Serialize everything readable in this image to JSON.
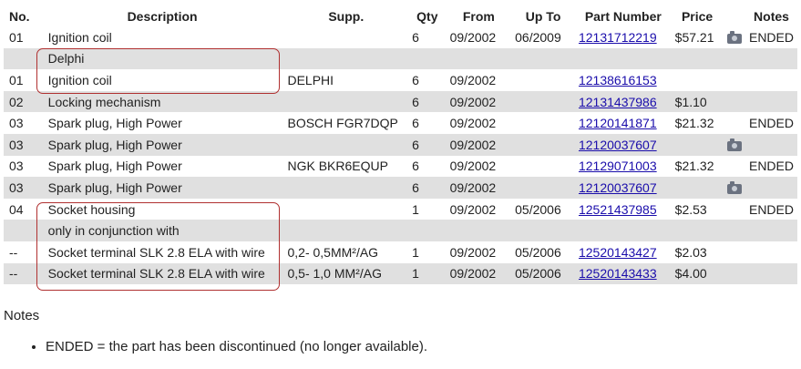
{
  "headers": {
    "no": "No.",
    "description": "Description",
    "supp": "Supp.",
    "qty": "Qty",
    "from": "From",
    "upto": "Up To",
    "part_number": "Part Number",
    "price": "Price",
    "notes": "Notes"
  },
  "rows": [
    {
      "no": "01",
      "desc": "Ignition coil",
      "supp": "",
      "qty": "6",
      "from": "09/2002",
      "upto": "06/2009",
      "part": "12131712219",
      "price": "$57.21",
      "pic": true,
      "note": "ENDED"
    },
    {
      "no": "",
      "desc": "Delphi",
      "supp": "",
      "qty": "",
      "from": "",
      "upto": "",
      "part": "",
      "price": "",
      "pic": false,
      "note": ""
    },
    {
      "no": "01",
      "desc": "Ignition coil",
      "supp": "DELPHI",
      "qty": "6",
      "from": "09/2002",
      "upto": "",
      "part": "12138616153",
      "price": "",
      "pic": false,
      "note": ""
    },
    {
      "no": "02",
      "desc": "Locking mechanism",
      "supp": "",
      "qty": "6",
      "from": "09/2002",
      "upto": "",
      "part": "12131437986",
      "price": "$1.10",
      "pic": false,
      "note": ""
    },
    {
      "no": "03",
      "desc": "Spark plug, High Power",
      "supp": "BOSCH FGR7DQP",
      "qty": "6",
      "from": "09/2002",
      "upto": "",
      "part": "12120141871",
      "price": "$21.32",
      "pic": false,
      "note": "ENDED"
    },
    {
      "no": "03",
      "desc": "Spark plug, High Power",
      "supp": "",
      "qty": "6",
      "from": "09/2002",
      "upto": "",
      "part": "12120037607",
      "price": "",
      "pic": true,
      "note": ""
    },
    {
      "no": "03",
      "desc": "Spark plug, High Power",
      "supp": "NGK BKR6EQUP",
      "qty": "6",
      "from": "09/2002",
      "upto": "",
      "part": "12129071003",
      "price": "$21.32",
      "pic": false,
      "note": "ENDED"
    },
    {
      "no": "03",
      "desc": "Spark plug, High Power",
      "supp": "",
      "qty": "6",
      "from": "09/2002",
      "upto": "",
      "part": "12120037607",
      "price": "",
      "pic": true,
      "note": ""
    },
    {
      "no": "04",
      "desc": "Socket housing",
      "supp": "",
      "qty": "1",
      "from": "09/2002",
      "upto": "05/2006",
      "part": "12521437985",
      "price": "$2.53",
      "pic": false,
      "note": "ENDED"
    },
    {
      "no": "",
      "desc": "only in conjunction with",
      "supp": "",
      "qty": "",
      "from": "",
      "upto": "",
      "part": "",
      "price": "",
      "pic": false,
      "note": ""
    },
    {
      "no": "--",
      "desc": "Socket terminal SLK 2.8 ELA with wire",
      "supp": "0,2- 0,5MM²/AG",
      "qty": "1",
      "from": "09/2002",
      "upto": "05/2006",
      "part": "12520143427",
      "price": "$2.03",
      "pic": false,
      "note": ""
    },
    {
      "no": "--",
      "desc": "Socket terminal SLK 2.8 ELA with wire",
      "supp": "0,5- 1,0 MM²/AG",
      "qty": "1",
      "from": "09/2002",
      "upto": "05/2006",
      "part": "12520143433",
      "price": "$4.00",
      "pic": false,
      "note": ""
    }
  ],
  "notes": {
    "title": "Notes",
    "items": [
      "ENDED = the part has been discontinued (no longer available)."
    ]
  },
  "icons": {
    "picture": "camera-icon"
  },
  "colors": {
    "link": "#1a0dab",
    "row_alt": "#e0e0e0",
    "group_border": "#b03030"
  }
}
